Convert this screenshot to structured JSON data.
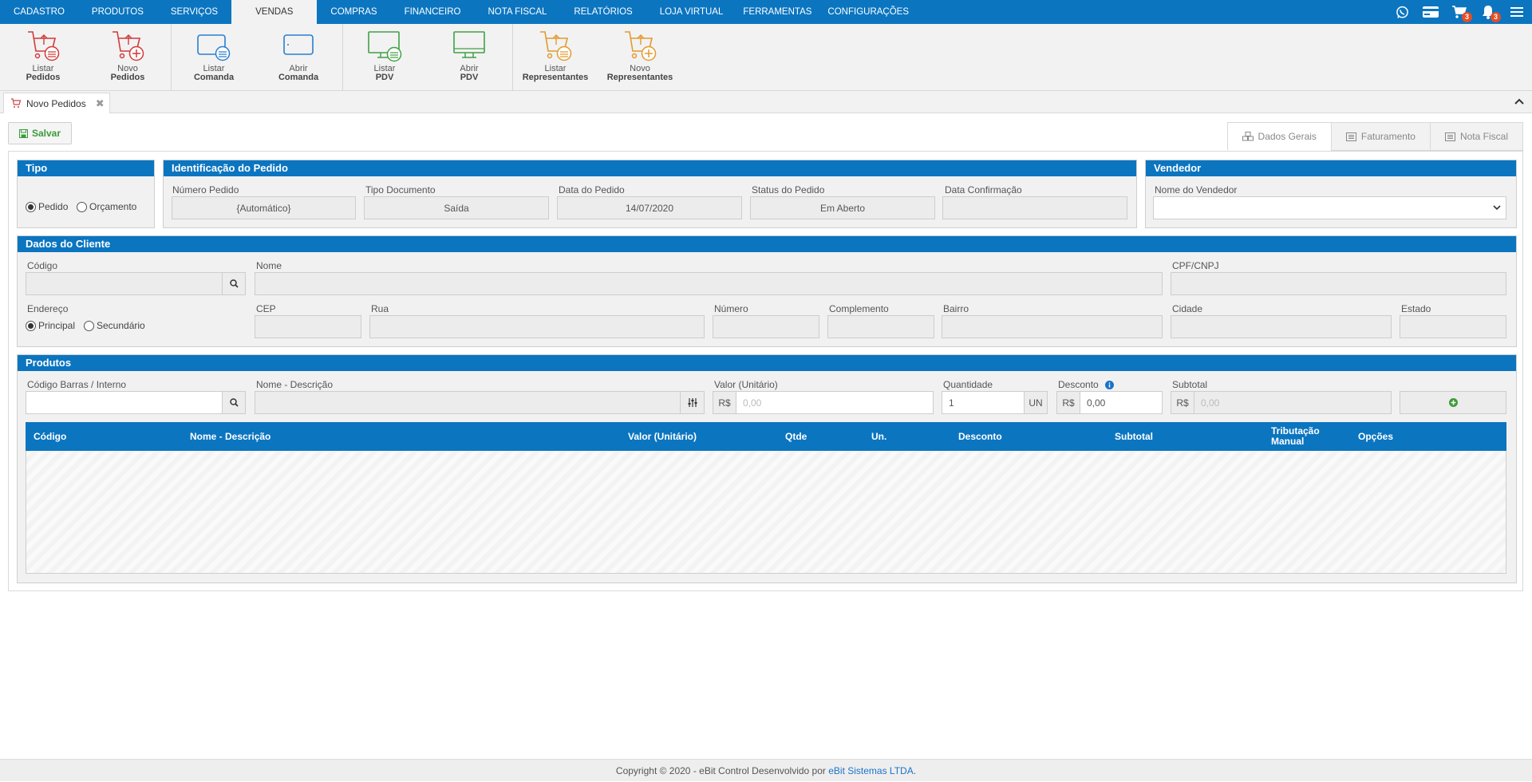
{
  "nav": {
    "menu": [
      {
        "label": "CADASTRO"
      },
      {
        "label": "PRODUTOS"
      },
      {
        "label": "SERVIÇOS"
      },
      {
        "label": "VENDAS"
      },
      {
        "label": "COMPRAS"
      },
      {
        "label": "FINANCEIRO"
      },
      {
        "label": "NOTA FISCAL"
      },
      {
        "label": "RELATÓRIOS"
      },
      {
        "label": "LOJA VIRTUAL"
      },
      {
        "label": "FERRAMENTAS"
      },
      {
        "label": "CONFIGURAÇÕES"
      }
    ],
    "active": "VENDAS",
    "icons": {
      "cart_badge": "3",
      "bell_badge": "3"
    }
  },
  "ribbon": {
    "buttons": [
      {
        "line1": "Listar",
        "line2": "Pedidos",
        "icon": "cart-list-icon",
        "color": "#d23b3b"
      },
      {
        "line1": "Novo",
        "line2": "Pedidos",
        "icon": "cart-add-icon",
        "color": "#d23b3b"
      },
      {
        "line1": "Listar",
        "line2": "Comanda",
        "icon": "tablet-list-icon",
        "color": "#2b7fd0"
      },
      {
        "line1": "Abrir",
        "line2": "Comanda",
        "icon": "tablet-icon",
        "color": "#2b7fd0"
      },
      {
        "line1": "Listar",
        "line2": "PDV",
        "icon": "monitor-list-icon",
        "color": "#43a047"
      },
      {
        "line1": "Abrir",
        "line2": "PDV",
        "icon": "monitor-icon",
        "color": "#43a047"
      },
      {
        "line1": "Listar",
        "line2": "Representantes",
        "icon": "cart-list-icon",
        "color": "#e39a2d"
      },
      {
        "line1": "Novo",
        "line2": "Representantes",
        "icon": "cart-add-icon",
        "color": "#e39a2d"
      }
    ]
  },
  "doc_tab": {
    "label": "Novo Pedidos"
  },
  "toolbar": {
    "save_label": "Salvar"
  },
  "subtabs": [
    {
      "label": "Dados Gerais"
    },
    {
      "label": "Faturamento"
    },
    {
      "label": "Nota Fiscal"
    }
  ],
  "tipo": {
    "title": "Tipo",
    "options": [
      "Pedido",
      "Orçamento"
    ],
    "selected": "Pedido"
  },
  "identificacao": {
    "title": "Identificação do Pedido",
    "numero_label": "Número Pedido",
    "numero_value": "{Automático}",
    "tipo_doc_label": "Tipo Documento",
    "tipo_doc_value": "Saída",
    "data_label": "Data do Pedido",
    "data_value": "14/07/2020",
    "status_label": "Status do Pedido",
    "status_value": "Em Aberto",
    "confirmacao_label": "Data Confirmação",
    "confirmacao_value": ""
  },
  "vendedor": {
    "title": "Vendedor",
    "nome_label": "Nome do Vendedor",
    "nome_value": ""
  },
  "cliente": {
    "title": "Dados do Cliente",
    "codigo_label": "Código",
    "nome_label": "Nome",
    "cpf_label": "CPF/CNPJ",
    "endereco_label": "Endereço",
    "endereco_options": [
      "Principal",
      "Secundário"
    ],
    "endereco_selected": "Principal",
    "cep_label": "CEP",
    "rua_label": "Rua",
    "numero_label": "Número",
    "complemento_label": "Complemento",
    "bairro_label": "Bairro",
    "cidade_label": "Cidade",
    "estado_label": "Estado"
  },
  "produtos": {
    "title": "Produtos",
    "codigo_label": "Código Barras / Interno",
    "nome_label": "Nome - Descrição",
    "valor_label": "Valor (Unitário)",
    "valor_prefix": "R$",
    "valor_placeholder": "0,00",
    "qtd_label": "Quantidade",
    "qtd_value": "1",
    "qtd_unit": "UN",
    "desconto_label": "Desconto",
    "desconto_prefix": "R$",
    "desconto_value": "0,00",
    "subtotal_label": "Subtotal",
    "subtotal_prefix": "R$",
    "subtotal_placeholder": "0,00",
    "table_headers": [
      "Código",
      "Nome - Descrição",
      "Valor (Unitário)",
      "Qtde",
      "Un.",
      "Desconto",
      "Subtotal",
      "Tributação Manual",
      "Opções"
    ],
    "rows": []
  },
  "footer": {
    "text": "Copyright © 2020 - eBit Control Desenvolvido por ",
    "link": "eBit Sistemas LTDA",
    "end": "."
  },
  "colors": {
    "primary": "#0b75c0",
    "save_green": "#3a9b3a",
    "badge": "#e54d26"
  }
}
